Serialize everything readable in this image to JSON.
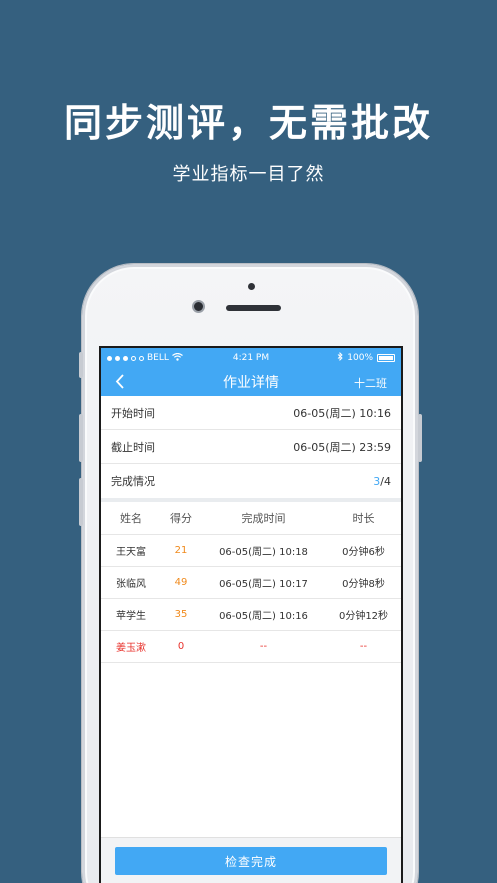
{
  "promo": {
    "headline": "同步测评，无需批改",
    "subline": "学业指标一目了然"
  },
  "status_bar": {
    "carrier": "BELL",
    "time": "4:21 PM",
    "battery": "100%"
  },
  "nav": {
    "title": "作业详情",
    "right_label": "十二班",
    "back_icon": "chevron-left-icon"
  },
  "info": {
    "start_label": "开始时间",
    "start_value": "06-05(周二) 10:16",
    "end_label": "截止时间",
    "end_value": "06-05(周二) 23:59",
    "completion_label": "完成情况",
    "completion_done": "3",
    "completion_total": "/4"
  },
  "table": {
    "headers": [
      "姓名",
      "得分",
      "完成时间",
      "时长"
    ],
    "rows": [
      {
        "name": "王天富",
        "score": "21",
        "time": "06-05(周二) 10:18",
        "duration": "0分钟6秒"
      },
      {
        "name": "张临风",
        "score": "49",
        "time": "06-05(周二) 10:17",
        "duration": "0分钟8秒"
      },
      {
        "name": "苹学生",
        "score": "35",
        "time": "06-05(周二) 10:16",
        "duration": "0分钟12秒"
      },
      {
        "name": "姜玉漱",
        "score": "0",
        "time": "--",
        "duration": "--"
      }
    ]
  },
  "footer": {
    "check_button": "检查完成"
  },
  "colors": {
    "background": "#35607f",
    "accent": "#42a8f4",
    "score": "#f08a1c",
    "incomplete": "#e8322c"
  }
}
